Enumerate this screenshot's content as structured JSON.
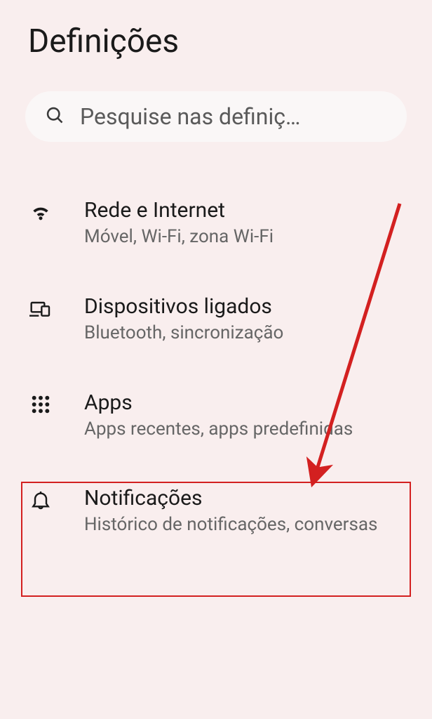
{
  "header": {
    "title": "Definições"
  },
  "search": {
    "placeholder": "Pesquise nas definiç…"
  },
  "items": [
    {
      "title": "Rede e Internet",
      "subtitle": "Móvel, Wi-Fi, zona Wi-Fi"
    },
    {
      "title": "Dispositivos ligados",
      "subtitle": "Bluetooth, sincronização"
    },
    {
      "title": "Apps",
      "subtitle": "Apps recentes, apps predefinidas"
    },
    {
      "title": "Notificações",
      "subtitle": "Histórico de notificações, conversas"
    }
  ],
  "annotation": {
    "highlight_color": "#d32020",
    "arrow_color": "#d32020",
    "highlighted_item_index": 2
  }
}
